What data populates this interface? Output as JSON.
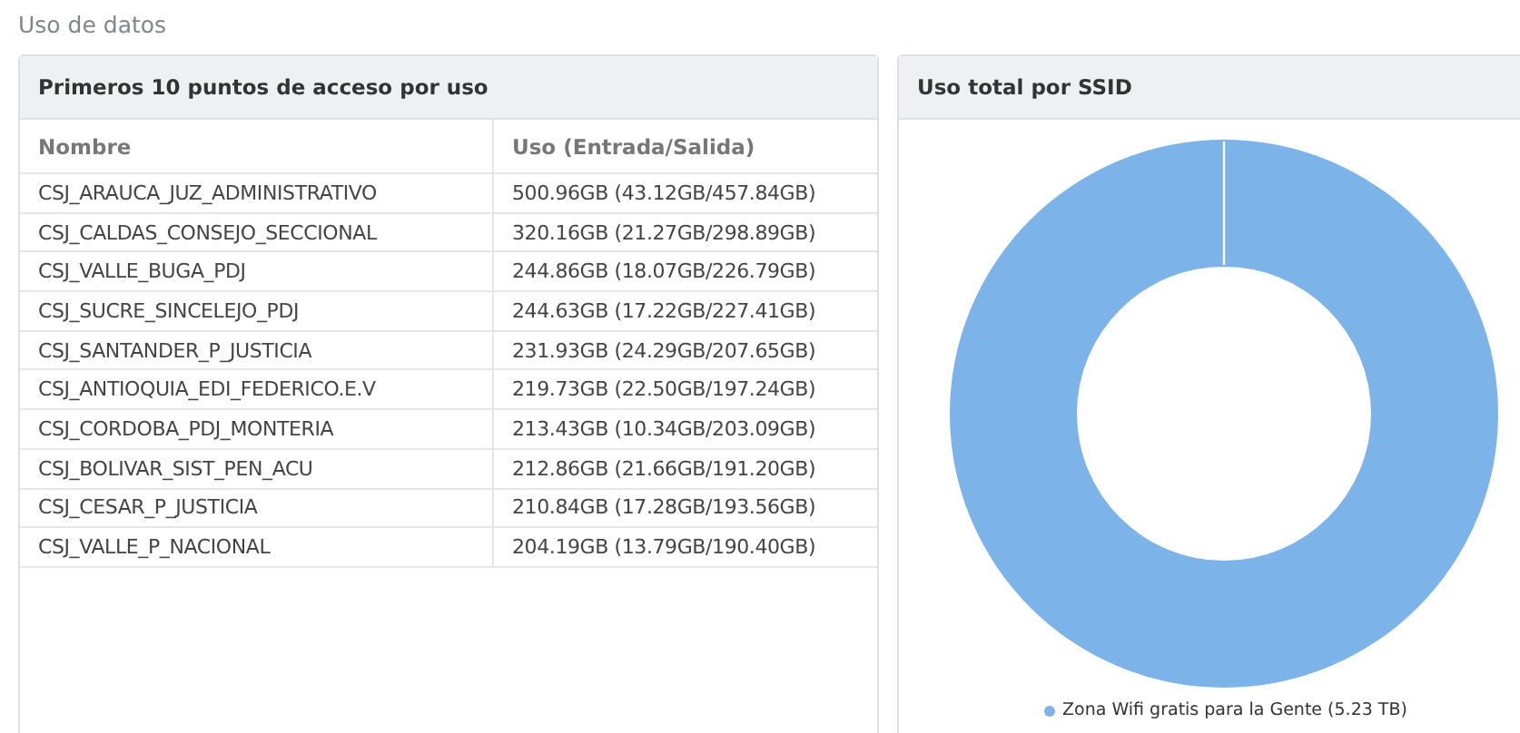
{
  "page_title": "Uso de datos",
  "top_access_points": {
    "title": "Primeros 10 puntos de acceso por uso",
    "columns": [
      "Nombre",
      "Uso (Entrada/Salida)"
    ],
    "rows": [
      [
        "CSJ_ARAUCA_JUZ_ADMINISTRATIVO",
        "500.96GB (43.12GB/457.84GB)"
      ],
      [
        "CSJ_CALDAS_CONSEJO_SECCIONAL",
        "320.16GB (21.27GB/298.89GB)"
      ],
      [
        "CSJ_VALLE_BUGA_PDJ",
        "244.86GB (18.07GB/226.79GB)"
      ],
      [
        "CSJ_SUCRE_SINCELEJO_PDJ",
        "244.63GB (17.22GB/227.41GB)"
      ],
      [
        "CSJ_SANTANDER_P_JUSTICIA",
        "231.93GB (24.29GB/207.65GB)"
      ],
      [
        "CSJ_ANTIOQUIA_EDI_FEDERICO.E.V",
        "219.73GB (22.50GB/197.24GB)"
      ],
      [
        "CSJ_CORDOBA_PDJ_MONTERIA",
        "213.43GB (10.34GB/203.09GB)"
      ],
      [
        "CSJ_BOLIVAR_SIST_PEN_ACU",
        "212.86GB (21.66GB/191.20GB)"
      ],
      [
        "CSJ_CESAR_P_JUSTICIA",
        "210.84GB (17.28GB/193.56GB)"
      ],
      [
        "CSJ_VALLE_P_NACIONAL",
        "204.19GB (13.79GB/190.40GB)"
      ]
    ]
  },
  "ssid_usage": {
    "title": "Uso total por SSID",
    "legend": [
      {
        "label": "Zona Wifi gratis para la Gente (5.23 TB)",
        "color": "#7cb3e9"
      }
    ]
  }
}
